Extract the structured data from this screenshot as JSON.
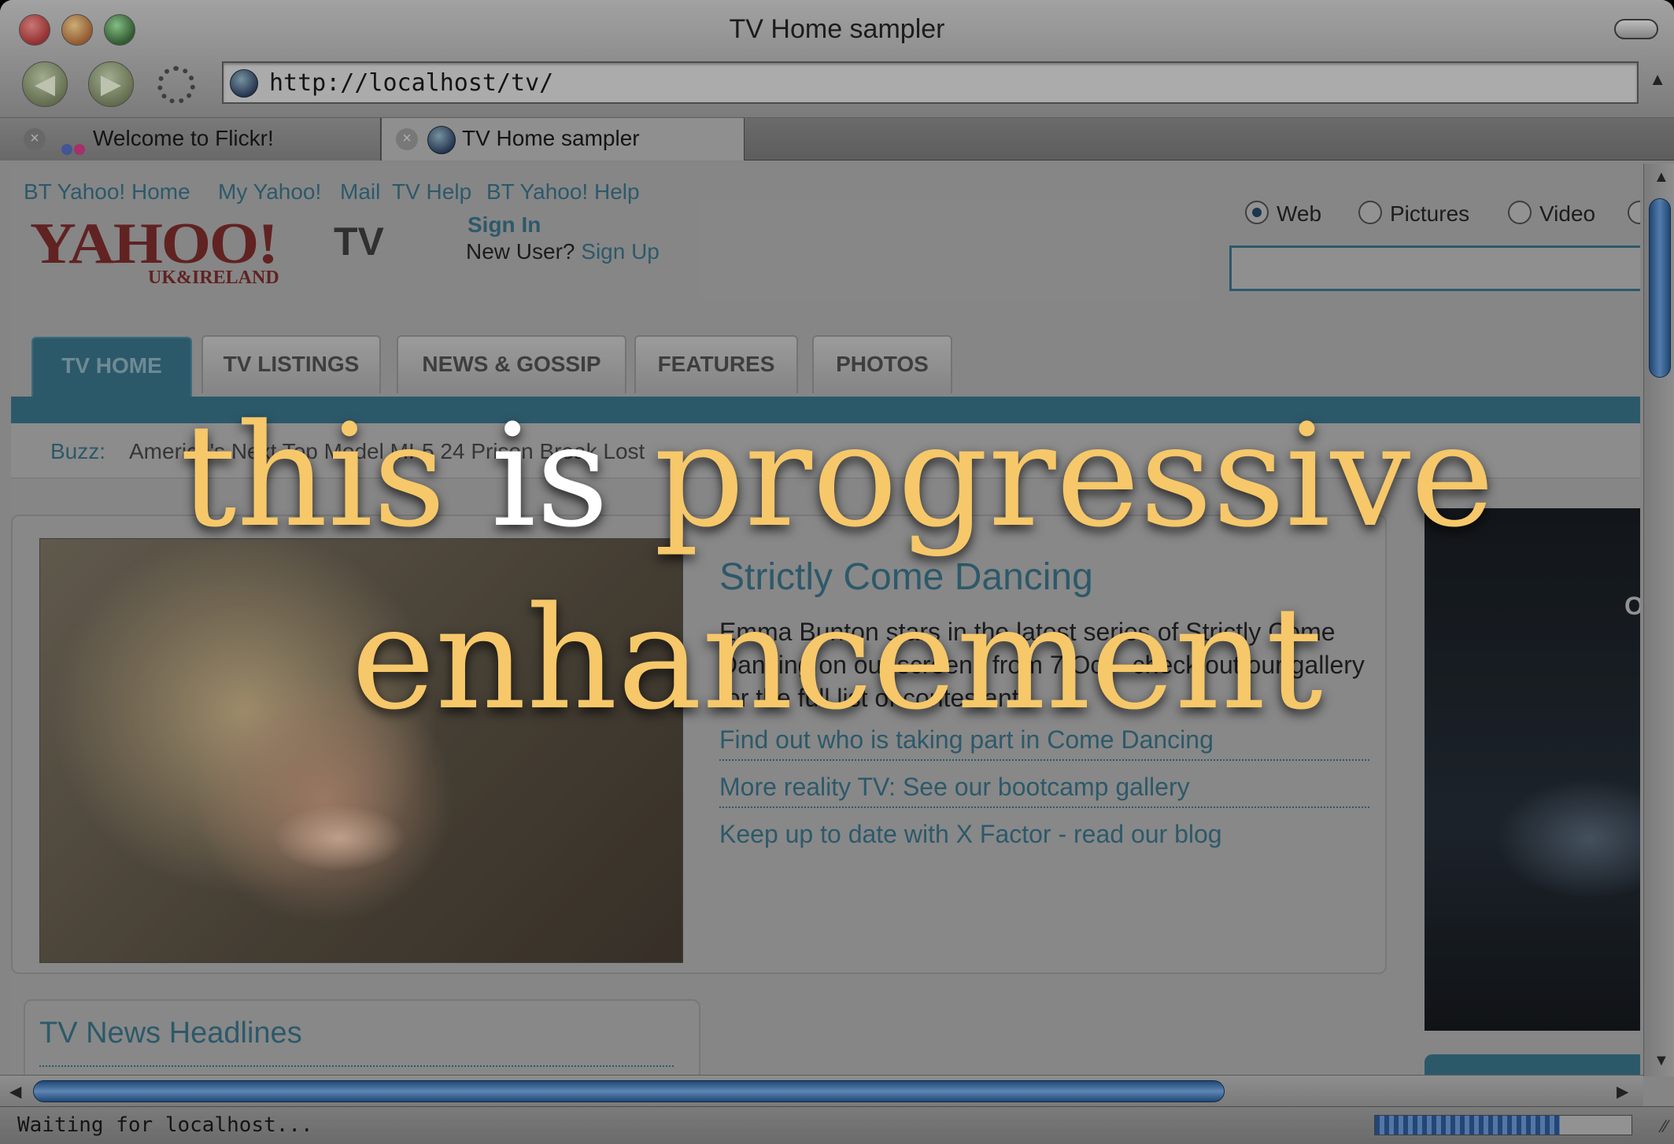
{
  "window": {
    "title": "TV Home sampler",
    "url": "http://localhost/tv/"
  },
  "tabs": [
    {
      "label": "Welcome to Flickr!",
      "active": false
    },
    {
      "label": "TV Home sampler",
      "active": true
    }
  ],
  "page": {
    "top_links": [
      "BT Yahoo! Home",
      "My Yahoo!",
      "Mail",
      "TV Help",
      "BT Yahoo! Help"
    ],
    "logo": {
      "main": "YAHOO!",
      "sub": "UK&IRELAND",
      "section": "TV"
    },
    "sign_in": "Sign In",
    "new_user": "New User?",
    "sign_up": "Sign Up",
    "search_options": [
      {
        "label": "Web",
        "selected": true
      },
      {
        "label": "Pictures",
        "selected": false
      },
      {
        "label": "Video",
        "selected": false
      }
    ],
    "nav_tabs": [
      "TV HOME",
      "TV LISTINGS",
      "NEWS & GOSSIP",
      "FEATURES",
      "PHOTOS"
    ],
    "buzz": {
      "label": "Buzz:",
      "text": "America's Next Top Model  MI-5  24  Prison Break  Lost"
    },
    "feature": {
      "title": "Strictly Come Dancing",
      "description": "Emma Bunton stars in the latest series of Strictly Come Dancing on our screens from 7 Oct - check out our gallery for the full list of contestants.",
      "links": [
        "Find out who is taking part in Come Dancing",
        "More reality TV: See our bootcamp gallery",
        "Keep up to date with X Factor - read our blog"
      ]
    },
    "ad_text": "On",
    "headlines_title": "TV News Headlines"
  },
  "status": {
    "text": "Waiting for localhost...",
    "progress": 0.72
  },
  "overlay": {
    "before": "this ",
    "highlight": "is",
    "after": " progressive",
    "line2": "enhancement"
  },
  "colors": {
    "link": "#2e6479",
    "overlay_text": "#f6c86a",
    "highlight": "#ffffff"
  }
}
